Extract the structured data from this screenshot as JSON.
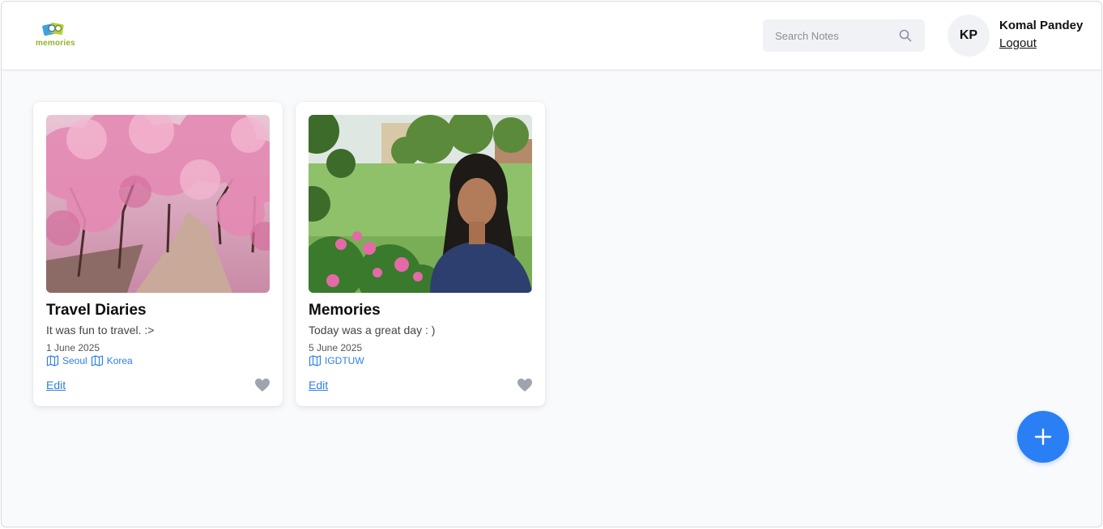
{
  "app": {
    "logo_text": "memories"
  },
  "search": {
    "placeholder": "Search Notes",
    "value": ""
  },
  "user": {
    "initials": "KP",
    "name": "Komal Pandey",
    "logout_label": "Logout"
  },
  "colors": {
    "accent": "#2b7ff4",
    "link": "#2f7fe6",
    "logo_green": "#8fb32a"
  },
  "notes": [
    {
      "title": "Travel Diaries",
      "content": "It was fun to travel. :>",
      "date": "1 June 2025",
      "tags": [
        "Seoul",
        "Korea"
      ],
      "edit_label": "Edit",
      "image_description": "cherry blossom path"
    },
    {
      "title": "Memories",
      "content": "Today was a great day : )",
      "date": "5 June 2025",
      "tags": [
        "IGDTUW"
      ],
      "edit_label": "Edit",
      "image_description": "portrait in garden"
    }
  ],
  "fab": {
    "icon": "plus-icon"
  }
}
